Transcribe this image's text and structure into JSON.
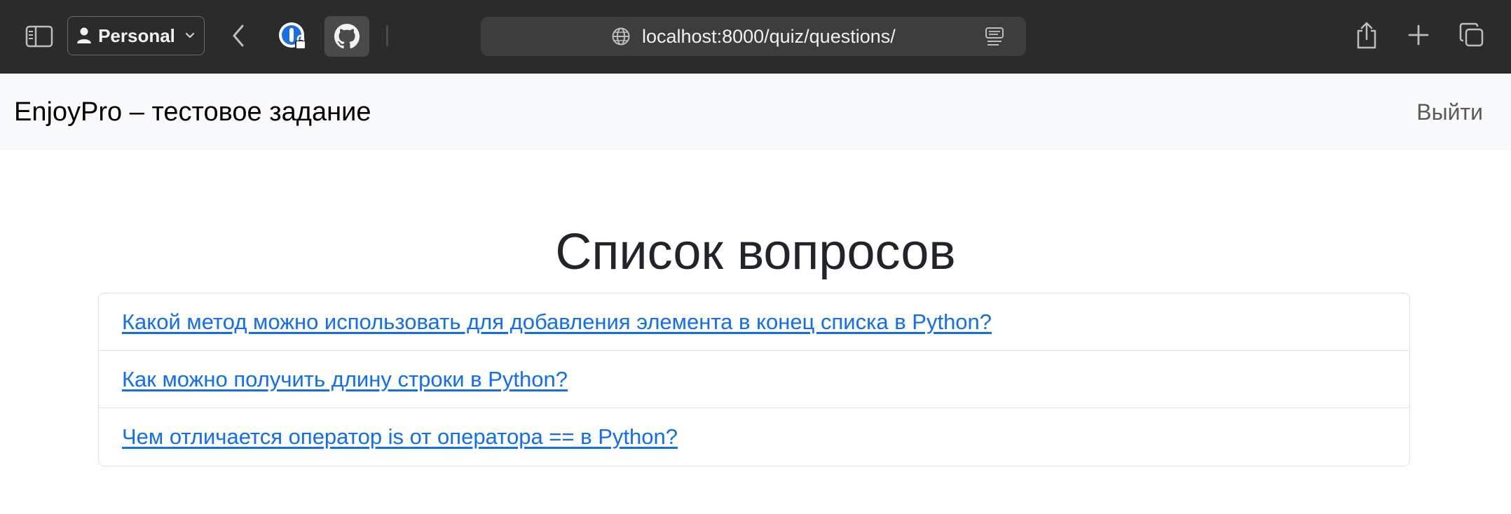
{
  "browser": {
    "profile_label": "Personal",
    "url": "localhost:8000/quiz/questions/",
    "icons": [
      "sidebar-icon",
      "person-icon",
      "chevron-down-icon",
      "back-icon",
      "onepassword-icon",
      "github-icon",
      "globe-icon",
      "reader-icon",
      "share-icon",
      "plus-icon",
      "tabs-overview-icon"
    ]
  },
  "navbar": {
    "brand": "EnjoyPro – тестовое задание",
    "logout": "Выйти"
  },
  "main": {
    "title": "Список вопросов",
    "questions": [
      "Какой метод можно использовать для добавления элемента в конец списка в Python?",
      "Как можно получить длину строки в Python?",
      "Чем отличается оператор is от оператора == в Python?"
    ]
  },
  "colors": {
    "link": "#0d6efd",
    "navbar_bg": "#f8f9fa",
    "chrome_bg": "#2b2b2b"
  }
}
